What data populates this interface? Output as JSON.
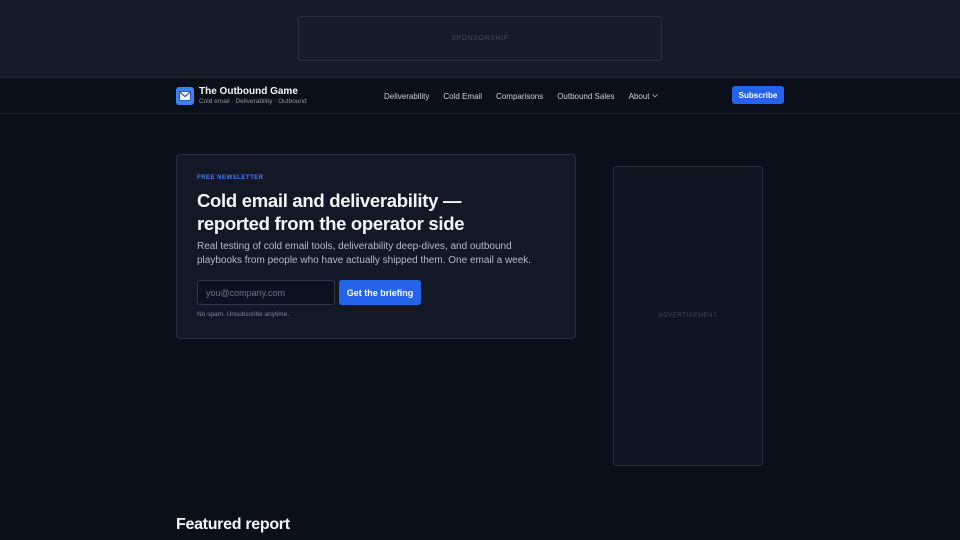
{
  "sponsorship": {
    "label": "SPONSORSHIP"
  },
  "brand": {
    "name": "The Outbound Game",
    "tagline": "Cold email · Deliverability · Outbound",
    "logo_color": "#3b82f6"
  },
  "nav": {
    "items": [
      {
        "label": "Deliverability"
      },
      {
        "label": "Cold Email"
      },
      {
        "label": "Comparisons"
      },
      {
        "label": "Outbound Sales"
      },
      {
        "label": "About",
        "icon": "chevron-down-icon"
      }
    ],
    "subscribe_label": "Subscribe"
  },
  "hero": {
    "eyebrow": "FREE NEWSLETTER",
    "headline": "Cold email and deliverability — reported from the operator side",
    "subcopy": "Real testing of cold email tools, deliverability deep-dives, and outbound playbooks from people who have actually shipped them. One email a week.",
    "email_placeholder": "you@company.com",
    "email_value": "",
    "cta_label": "Get the briefing",
    "fineprint": "No spam. Unsubscribe anytime."
  },
  "ad": {
    "label": "ADVERTISEMENT"
  },
  "featured": {
    "title": "Featured report"
  },
  "colors": {
    "accent": "#2563eb",
    "background": "#0b0f1a",
    "card": "#131826"
  }
}
